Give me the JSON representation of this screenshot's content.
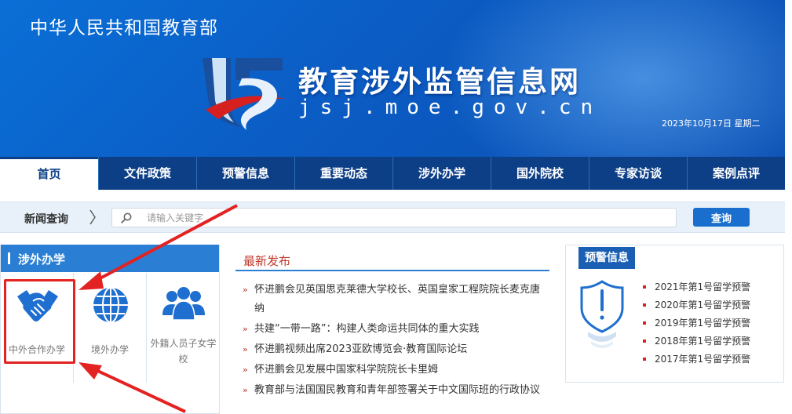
{
  "header": {
    "ministry": "中华人民共和国教育部",
    "site_name": "教育涉外监管信息网",
    "domain": "jsj.moe.gov.cn",
    "date": "2023年10月17日  星期二"
  },
  "nav": {
    "items": [
      {
        "label": "首页"
      },
      {
        "label": "文件政策"
      },
      {
        "label": "预警信息"
      },
      {
        "label": "重要动态"
      },
      {
        "label": "涉外办学"
      },
      {
        "label": "国外院校"
      },
      {
        "label": "专家访谈"
      },
      {
        "label": "案例点评"
      }
    ]
  },
  "search": {
    "label": "新闻查询",
    "placeholder": "请输入关键字",
    "button_label": "查询"
  },
  "left_panel": {
    "title": "涉外办学",
    "tiles": [
      {
        "label": "中外合作办学",
        "icon": "handshake-icon"
      },
      {
        "label": "境外办学",
        "icon": "globe-icon"
      },
      {
        "label": "外籍人员子女学校",
        "icon": "people-group-icon"
      }
    ]
  },
  "center_panel": {
    "title": "最新发布",
    "marker": "»",
    "items": [
      "怀进鹏会见英国思克莱德大学校长、英国皇家工程院院长麦克唐纳",
      "共建“一带一路”：构建人类命运共同体的重大实践",
      "怀进鹏视频出席2023亚欧博览会·教育国际论坛",
      "怀进鹏会见发展中国家科学院院长卡里姆",
      "教育部与法国国民教育和青年部签署关于中文国际班的行政协议"
    ]
  },
  "right_panel": {
    "title": "预警信息",
    "icon": "shield-alert-icon",
    "items": [
      "2021年第1号留学预警",
      "2020年第1号留学预警",
      "2019年第1号留学预警",
      "2018年第1号留学预警",
      "2017年第1号留学预警"
    ]
  },
  "colors": {
    "banner_blue": "#0b5cc4",
    "nav_blue": "#0d3f86",
    "accent_blue": "#2a7fd4",
    "annotation_red": "#e32222"
  }
}
